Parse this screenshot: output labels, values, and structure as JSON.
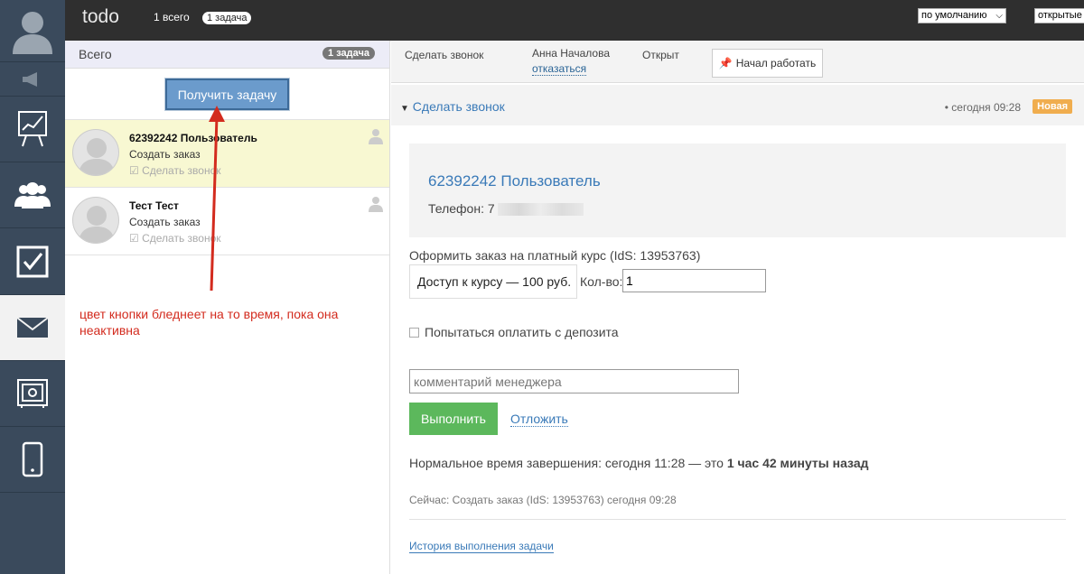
{
  "topbar": {
    "app_title": "todo",
    "count_text": "1 всего",
    "badge_text": "1 задача",
    "sort_select": "по умолчанию",
    "filter_select": "открытые"
  },
  "rail": {
    "items": [
      "user-icon",
      "megaphone-icon",
      "chart-board-icon",
      "users-group-icon",
      "checkbox-icon",
      "envelope-icon",
      "safe-icon",
      "phone-icon"
    ],
    "active": "envelope-icon"
  },
  "list": {
    "header_title": "Всего",
    "header_badge": "1 задача",
    "get_task_label": "Получить задачу",
    "tasks": [
      {
        "name": "62392242 Пользователь",
        "action": "Создать заказ",
        "type": "Сделать звонок",
        "selected": true
      },
      {
        "name": "Тест Тест",
        "action": "Создать заказ",
        "type": "Сделать звонок",
        "selected": false
      }
    ],
    "annotation": "цвет кнопки бледнеет на то время, пока она неактивна"
  },
  "detail": {
    "head": {
      "task": "Сделать звонок",
      "assignee": "Анна Началова",
      "refuse_link": "отказаться",
      "status": "Открыт",
      "start_button": "Начал работать"
    },
    "section": {
      "title": "Сделать звонок",
      "time": "• сегодня 09:28",
      "status_badge": "Новая"
    },
    "client": {
      "name": "62392242 Пользователь",
      "phone_label": "Телефон: 7"
    },
    "order": {
      "label": "Оформить заказ на платный курс (IdS: 13953763)",
      "course": "Доступ к курсу — 100 руб.",
      "qty_label": "Кол-во:",
      "qty_value": "1",
      "deposit_label": "Попытаться оплатить с депозита",
      "comment_placeholder": "комментарий менеджера",
      "execute_label": "Выполнить",
      "postpone_label": "Отложить"
    },
    "normal_time_prefix": "Нормальное время завершения: сегодня 11:28 — это ",
    "normal_time_bold": "1 час 42 минуты назад",
    "now_line": "Сейчас: Создать заказ (IdS: 13953763) сегодня 09:28",
    "history_link": "История выполнения задачи"
  },
  "colors": {
    "rail_bg": "#3a4a5c",
    "topbar_bg": "#2f2f2f",
    "primary_btn": "#6b9bcc",
    "success_btn": "#5cb85c",
    "new_badge": "#f0ad4e",
    "selected_row": "#f8f8d2",
    "annotation": "#d32b1e"
  }
}
